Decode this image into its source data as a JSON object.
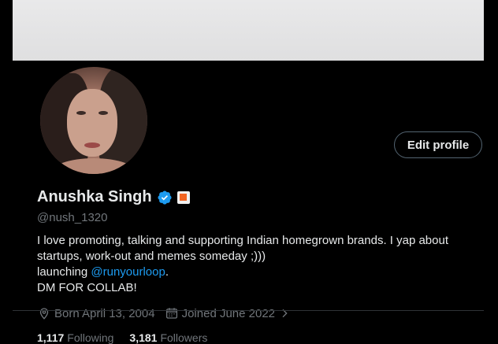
{
  "profile": {
    "name": "Anushka Singh",
    "handle": "@nush_1320",
    "edit_label": "Edit profile",
    "bio": {
      "line1": "I love promoting, talking and supporting Indian homegrown brands. I yap about",
      "line2": "startups, work-out and memes someday ;)))",
      "line3_prefix": "launching ",
      "line3_mention": "@runyourloop",
      "line3_suffix": ".",
      "line4": "DM FOR COLLAB!"
    },
    "born": "Born April 13, 2004",
    "joined": "Joined June 2022",
    "following_count": "1,117",
    "following_label": "Following",
    "followers_count": "3,181",
    "followers_label": "Followers"
  },
  "colors": {
    "accent": "#1d9bf0",
    "muted": "#71767b",
    "text": "#e7e9ea",
    "background": "#000000"
  },
  "icons": [
    "verified-icon",
    "affiliate-badge-icon",
    "location-pin-icon",
    "calendar-icon",
    "chevron-right-icon"
  ]
}
